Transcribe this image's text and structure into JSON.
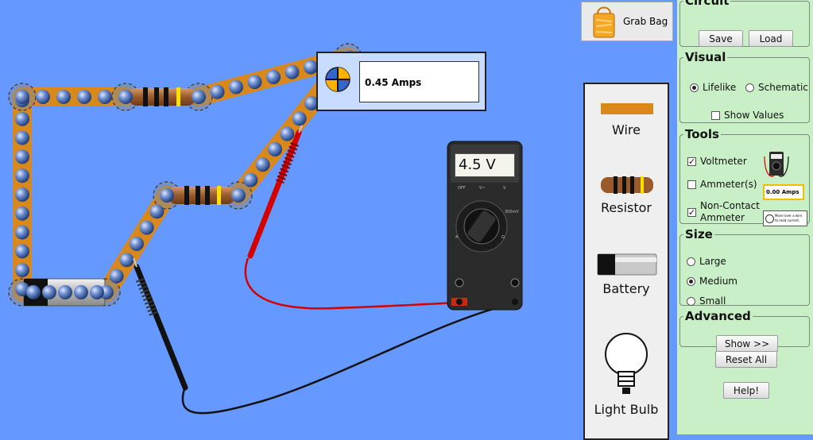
{
  "grab_bag": {
    "label": "Grab Bag",
    "icon": "bag-icon"
  },
  "toolbox": {
    "items": [
      {
        "label": "Wire",
        "icon": "wire-icon"
      },
      {
        "label": "Resistor",
        "icon": "resistor-icon"
      },
      {
        "label": "Battery",
        "icon": "battery-icon"
      },
      {
        "label": "Light Bulb",
        "icon": "light-bulb-icon"
      }
    ]
  },
  "ammeter": {
    "reading": "0.45 Amps",
    "icon": "ammeter-icon"
  },
  "voltmeter": {
    "reading": "4.5 V",
    "icon": "multimeter-icon"
  },
  "panel": {
    "circuit": {
      "title": "Circuit",
      "save": "Save",
      "load": "Load"
    },
    "visual": {
      "title": "Visual",
      "lifelike": "Lifelike",
      "schematic": "Schematic",
      "selected": "Lifelike",
      "show_values": "Show Values",
      "show_values_checked": false
    },
    "tools": {
      "title": "Tools",
      "voltmeter": "Voltmeter",
      "voltmeter_checked": true,
      "ammeters": "Ammeter(s)",
      "ammeters_checked": false,
      "noncontact_1": "Non-Contact",
      "noncontact_2": "Ammeter",
      "noncontact_checked": true,
      "ammeter_thumb": "0.00 Amps",
      "noncontact_thumb": "Move over a wire to read current."
    },
    "size": {
      "title": "Size",
      "large": "Large",
      "medium": "Medium",
      "small": "Small",
      "selected": "Medium"
    },
    "advanced": {
      "title": "Advanced",
      "show": "Show >>"
    },
    "reset_all": "Reset All",
    "help": "Help!"
  },
  "colors": {
    "background": "#6699ff",
    "wire": "#d9891c",
    "panel": "#c9efc6",
    "probe_red": "#d40000",
    "probe_black": "#111111"
  }
}
